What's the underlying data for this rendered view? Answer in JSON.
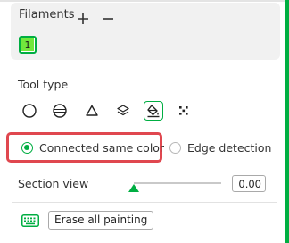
{
  "filaments": {
    "title": "Filaments",
    "add_icon": "plus-icon",
    "remove_icon": "minus-icon",
    "items": [
      {
        "label": "1",
        "color": "#71e83c",
        "selected": true
      }
    ]
  },
  "tool_type": {
    "label": "Tool type",
    "tools": [
      {
        "icon": "circle-tool-icon",
        "selected": false
      },
      {
        "icon": "sphere-tool-icon",
        "selected": false
      },
      {
        "icon": "triangle-tool-icon",
        "selected": false
      },
      {
        "icon": "height-range-tool-icon",
        "selected": false
      },
      {
        "icon": "fill-bucket-tool-icon",
        "selected": true
      },
      {
        "icon": "gap-fill-tool-icon",
        "selected": false
      }
    ]
  },
  "fill_mode": {
    "options": [
      {
        "label": "Connected same color",
        "checked": true
      },
      {
        "label": "Edge detection",
        "checked": false
      }
    ]
  },
  "section_view": {
    "label": "Section view",
    "value": "0.00",
    "level": 0
  },
  "actions": {
    "shortcut_icon": "keyboard-icon",
    "erase_label": "Erase all painting"
  },
  "colors": {
    "accent": "#00ae42",
    "highlight": "#e0474f",
    "filament_1": "#71e83c"
  }
}
